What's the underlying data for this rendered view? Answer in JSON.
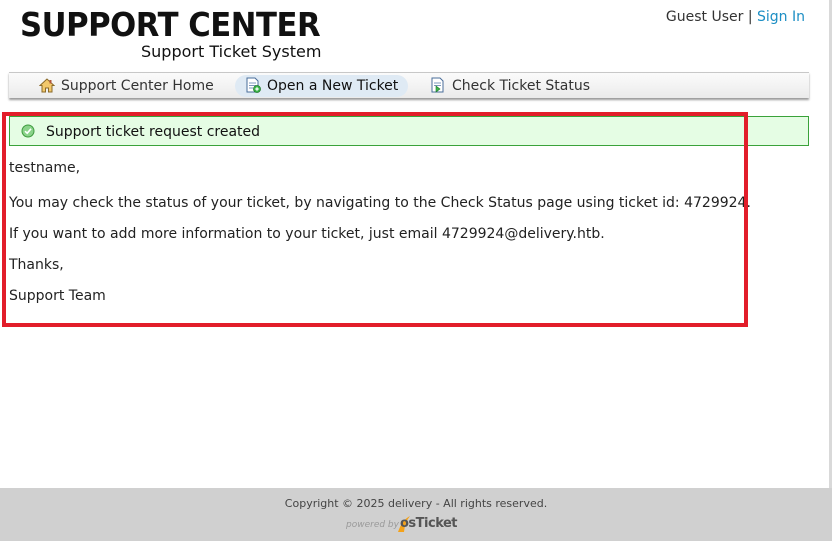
{
  "header": {
    "logo_title": "SUPPORT CENTER",
    "logo_subtitle": "Support Ticket System",
    "guest_user": "Guest User",
    "separator": "|",
    "sign_in": "Sign In"
  },
  "nav": {
    "items": [
      {
        "label": "Support Center Home",
        "icon": "home-icon"
      },
      {
        "label": "Open a New Ticket",
        "icon": "new-ticket-icon",
        "active": true
      },
      {
        "label": "Check Ticket Status",
        "icon": "ticket-status-icon"
      }
    ]
  },
  "notice": {
    "message": "Support ticket request created",
    "icon": "check-circle-icon"
  },
  "message": {
    "greeting": "testname,",
    "line1": "You may check the status of your ticket, by navigating to the Check Status page using ticket id: 4729924.",
    "line2": "If you want to add more information to your ticket, just email 4729924@delivery.htb.",
    "closing": "Thanks,",
    "signature": "Support Team"
  },
  "footer": {
    "copyright": "Copyright © 2025 delivery - All rights reserved.",
    "powered_by": "powered by",
    "brand": "osTicket"
  },
  "colors": {
    "link": "#1c8ec4",
    "notice_bg": "#e5fde4",
    "notice_border": "#3aa23a",
    "highlight_box": "#e21d2a",
    "footer_bg": "#d0d0d0"
  }
}
